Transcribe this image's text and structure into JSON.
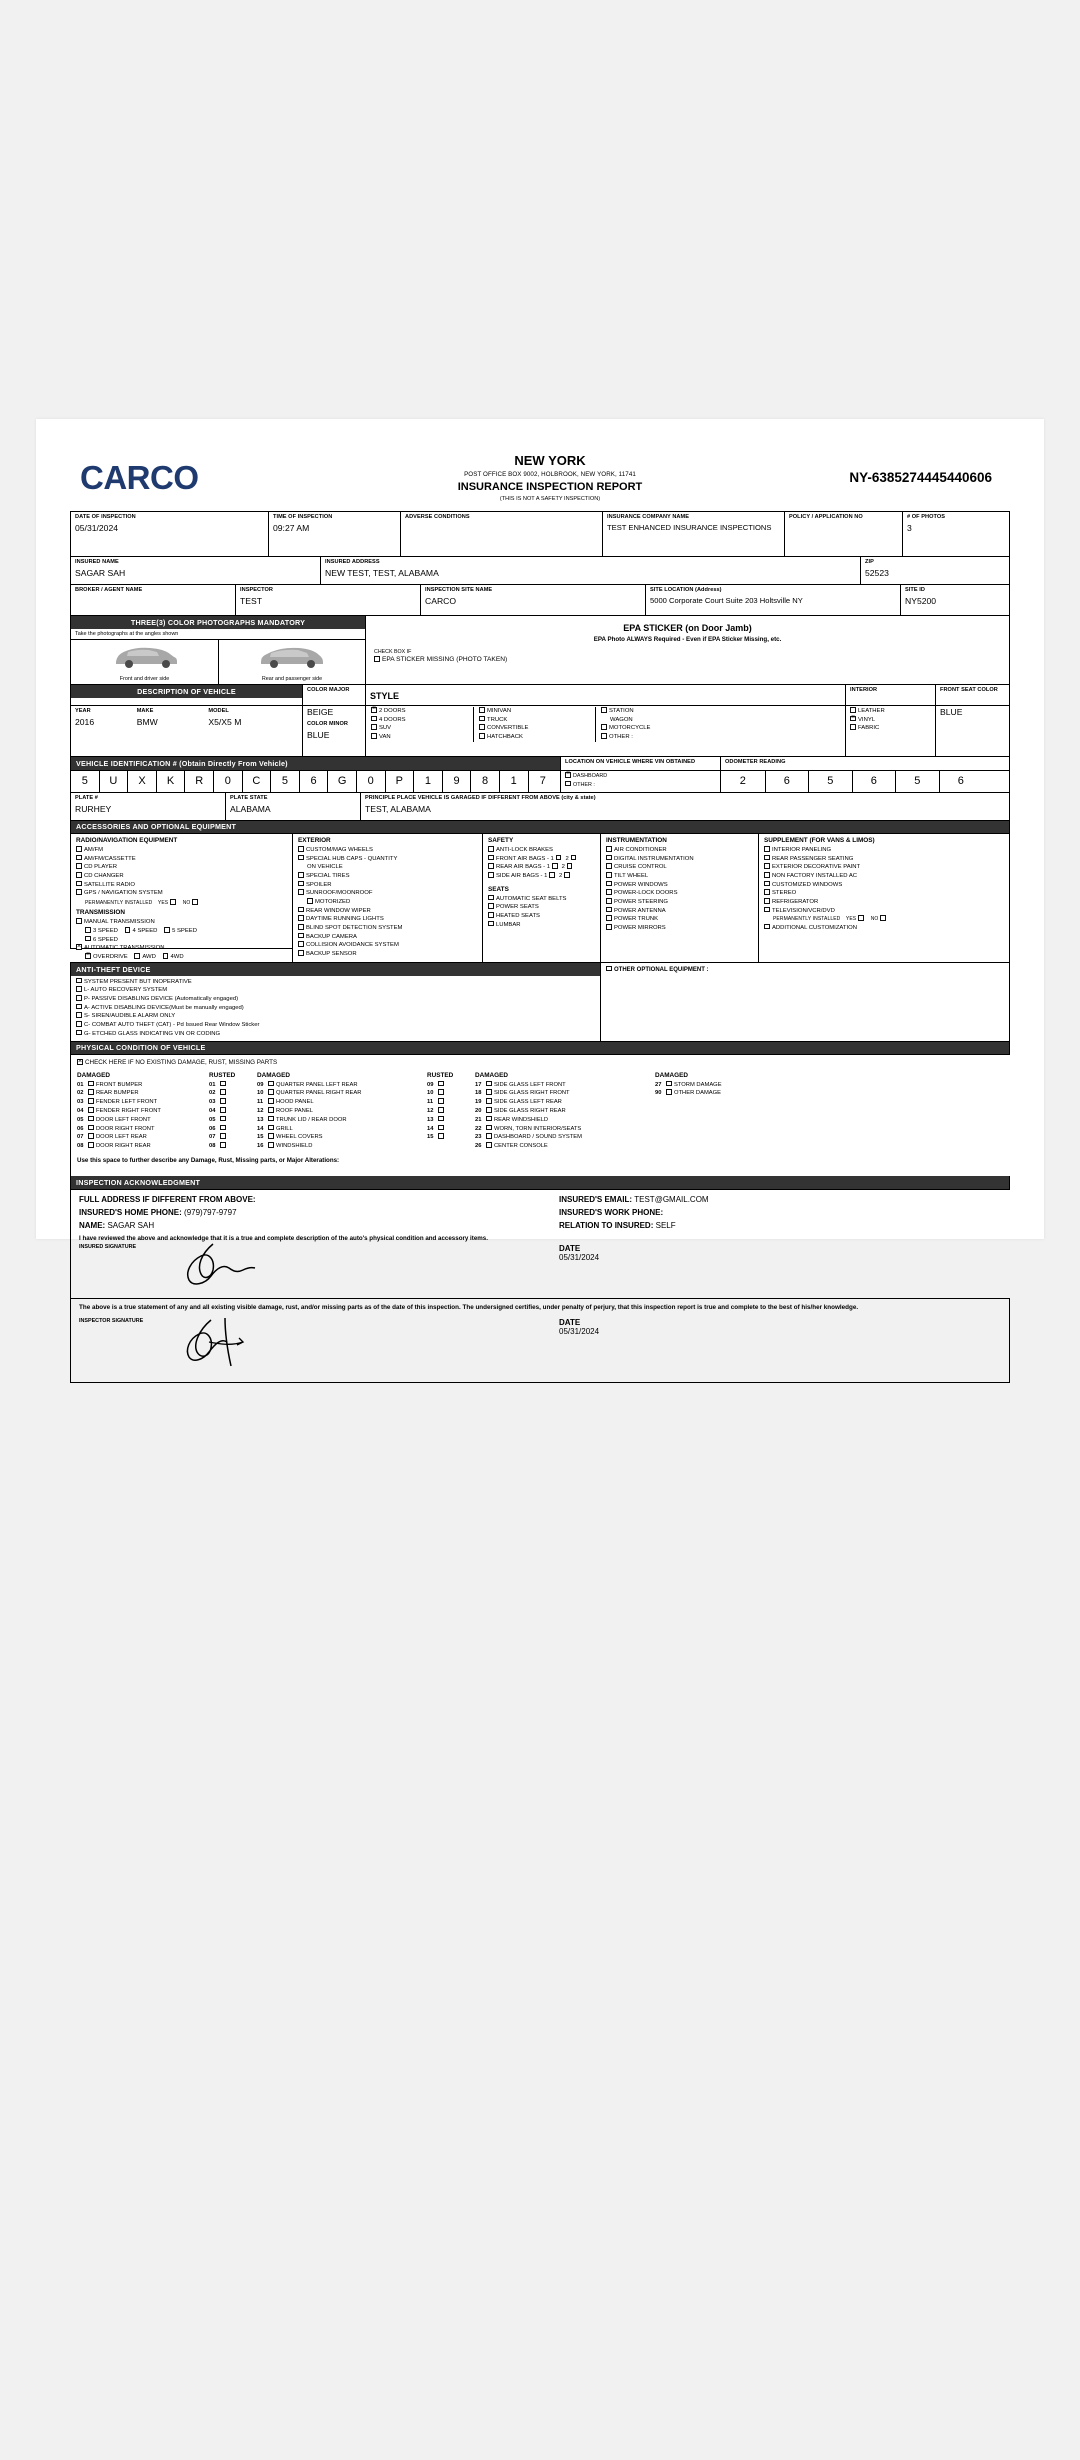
{
  "header": {
    "logo": "CARCO",
    "state": "NEW YORK",
    "address": "POST OFFICE BOX 9002, HOLBROOK, NEW YORK, 11741",
    "title": "INSURANCE INSPECTION REPORT",
    "note": "(THIS IS NOT A SAFETY INSPECTION)",
    "report_number": "NY-6385274445440606"
  },
  "inspection": {
    "date_label": "DATE OF INSPECTION",
    "date_value": "05/31/2024",
    "time_label": "TIME OF INSPECTION",
    "time_value": "09:27 AM",
    "adverse_label": "ADVERSE CONDITIONS",
    "adverse_value": "",
    "company_label": "INSURANCE COMPANY NAME",
    "company_value": "TEST ENHANCED INSURANCE INSPECTIONS",
    "policy_label": "POLICY / APPLICATION NO",
    "policy_value": "",
    "photos_label": "# OF PHOTOS",
    "photos_value": "3",
    "insured_name_label": "INSURED NAME",
    "insured_name_value": "SAGAR SAH",
    "insured_address_label": "INSURED ADDRESS",
    "insured_address_value": "NEW TEST, TEST, ALABAMA",
    "zip_label": "ZIP",
    "zip_value": "52523",
    "broker_label": "BROKER / AGENT NAME",
    "broker_value": "",
    "inspector_label": "INSPECTOR",
    "inspector_value": "TEST",
    "site_name_label": "INSPECTION SITE NAME",
    "site_name_value": "CARCO",
    "site_loc_label": "SITE LOCATION (Address)",
    "site_loc_value": "5000 Corporate Court Suite 203 Holtsville NY",
    "site_id_label": "SITE ID",
    "site_id_value": "NY5200"
  },
  "photos": {
    "band": "THREE(3) COLOR PHOTOGRAPHS MANDATORY",
    "note": "Take the photographs at the angles shown",
    "caption_left": "Front and driver side",
    "caption_right": "Rear and passenger side"
  },
  "epa": {
    "title": "EPA STICKER (on Door Jamb)",
    "subtitle": "EPA Photo ALWAYS Required - Even if EPA Sticker Missing, etc.",
    "checkbox_if": "CHECK BOX IF",
    "missing_label": "EPA STICKER MISSING (PHOTO TAKEN)",
    "missing_checked": false
  },
  "vehicle": {
    "band": "DESCRIPTION OF VEHICLE",
    "year_label": "YEAR",
    "year_value": "2016",
    "make_label": "MAKE",
    "make_value": "BMW",
    "model_label": "MODEL",
    "model_value": "X5/X5 M",
    "color_major_label": "COLOR MAJOR",
    "color_major_value": "BEIGE",
    "color_minor_label": "COLOR MINOR",
    "color_minor_value": "BLUE",
    "style_label": "STYLE",
    "style_col1": [
      {
        "label": "2 DOORS",
        "checked": true
      },
      {
        "label": "4 DOORS",
        "checked": false
      },
      {
        "label": "SUV",
        "checked": false
      },
      {
        "label": "VAN",
        "checked": false
      }
    ],
    "style_col2": [
      {
        "label": "MINIVAN",
        "checked": false
      },
      {
        "label": "TRUCK",
        "checked": false
      },
      {
        "label": "CONVERTIBLE",
        "checked": false
      },
      {
        "label": "HATCHBACK",
        "checked": false
      }
    ],
    "style_col3": [
      {
        "label": "STATION WAGON",
        "checked": false
      },
      {
        "label": "MOTORCYCLE",
        "checked": false
      },
      {
        "label": "OTHER :",
        "checked": false
      }
    ],
    "interior_label": "INTERIOR",
    "interior": [
      {
        "label": "LEATHER",
        "checked": false
      },
      {
        "label": "VINYL",
        "checked": true
      },
      {
        "label": "FABRIC",
        "checked": false
      }
    ],
    "front_seat_color_label": "FRONT SEAT COLOR",
    "front_seat_color_value": "BLUE"
  },
  "vin": {
    "band": "VEHICLE IDENTIFICATION # (Obtain Directly From Vehicle)",
    "chars": [
      "5",
      "U",
      "X",
      "K",
      "R",
      "0",
      "C",
      "5",
      "6",
      "G",
      "0",
      "P",
      "1",
      "9",
      "8",
      "1",
      "7"
    ],
    "location_label": "LOCATION ON VEHICLE WHERE VIN OBTAINED",
    "location_options": [
      {
        "label": "DASHBOARD",
        "checked": true
      },
      {
        "label": "OTHER :",
        "checked": false
      }
    ],
    "odometer_label": "ODOMETER READING",
    "odometer_digits": [
      "2",
      "6",
      "5",
      "6",
      "5",
      "6"
    ]
  },
  "plate": {
    "plate_label": "PLATE #",
    "plate_value": "RURHEY",
    "state_label": "PLATE STATE",
    "state_value": "ALABAMA",
    "garaged_label": "PRINCIPLE PLACE VEHICLE IS GARAGED IF DIFFERENT FROM ABOVE (city & state)",
    "garaged_value": "TEST, ALABAMA"
  },
  "accessories": {
    "band": "ACCESSORIES AND OPTIONAL EQUIPMENT",
    "radio_title": "RADIO/NAVIGATION EQUIPMENT",
    "radio": [
      {
        "label": "AM/FM",
        "checked": false
      },
      {
        "label": "AM/FM/CASSETTE",
        "checked": false
      },
      {
        "label": "CD PLAYER",
        "checked": false
      },
      {
        "label": "CD CHANGER",
        "checked": false
      },
      {
        "label": "SATELLITE RADIO",
        "checked": false
      },
      {
        "label": "GPS / NAVIGATION SYSTEM",
        "checked": false
      }
    ],
    "perm_installed": "PERMANENTLY INSTALLED",
    "yes_label": "YES",
    "no_label": "NO",
    "transmission_title": "TRANSMISSION",
    "manual_label": "MANUAL TRANSMISSION",
    "manual_checked": false,
    "speeds": [
      {
        "label": "3 SPEED",
        "checked": false
      },
      {
        "label": "4 SPEED",
        "checked": false
      },
      {
        "label": "5 SPEED",
        "checked": false
      },
      {
        "label": "6 SPEED",
        "checked": false
      }
    ],
    "automatic_label": "AUTOMATIC TRANSMISSION",
    "automatic_checked": true,
    "drive": [
      {
        "label": "OVERDRIVE",
        "checked": true
      },
      {
        "label": "AWD",
        "checked": false
      },
      {
        "label": "4WD",
        "checked": false
      }
    ],
    "exterior_title": "EXTERIOR",
    "exterior": [
      {
        "label": "CUSTOM/MAG WHEELS",
        "checked": false
      },
      {
        "label": "SPECIAL HUB CAPS - QUANTITY",
        "checked": false
      },
      {
        "label": "ON VEHICLE",
        "checked": null
      },
      {
        "label": "SPECIAL TIRES",
        "checked": false
      },
      {
        "label": "SPOILER",
        "checked": false
      },
      {
        "label": "SUNROOF/MOONROOF",
        "checked": false
      },
      {
        "label": "MOTORIZED",
        "checked": false,
        "indent": true
      },
      {
        "label": "REAR WINDOW WIPER",
        "checked": false
      },
      {
        "label": "DAYTIME RUNNING LIGHTS",
        "checked": false
      },
      {
        "label": "BLIND SPOT DETECTION SYSTEM",
        "checked": false
      },
      {
        "label": "BACKUP CAMERA",
        "checked": false
      },
      {
        "label": "COLLISION AVOIDANCE SYSTEM",
        "checked": false
      },
      {
        "label": "BACKUP SENSOR",
        "checked": false
      }
    ],
    "safety_title": "SAFETY",
    "safety": [
      {
        "label": "ANTI-LOCK BRAKES",
        "checked": false
      },
      {
        "label": "FRONT AIR BAGS -",
        "checked": false,
        "counts": true
      },
      {
        "label": "REAR AIR BAGS -",
        "checked": false,
        "counts": true
      },
      {
        "label": "SIDE AIR BAGS -",
        "checked": false,
        "counts": true
      }
    ],
    "seats_title": "SEATS",
    "seats": [
      {
        "label": "AUTOMATIC SEAT BELTS",
        "checked": false
      },
      {
        "label": "POWER SEATS",
        "checked": false
      },
      {
        "label": "HEATED SEATS",
        "checked": false
      },
      {
        "label": "LUMBAR",
        "checked": false
      }
    ],
    "instrumentation_title": "INSTRUMENTATION",
    "instrumentation": [
      {
        "label": "AIR CONDITIONER",
        "checked": false
      },
      {
        "label": "DIGITAL INSTRUMENTATION",
        "checked": false
      },
      {
        "label": "CRUISE CONTROL",
        "checked": false
      },
      {
        "label": "TILT WHEEL",
        "checked": false
      },
      {
        "label": "POWER WINDOWS",
        "checked": false
      },
      {
        "label": "POWER-LOCK DOORS",
        "checked": false
      },
      {
        "label": "POWER STEERING",
        "checked": false
      },
      {
        "label": "POWER ANTENNA",
        "checked": false
      },
      {
        "label": "POWER TRUNK",
        "checked": false
      },
      {
        "label": "POWER MIRRORS",
        "checked": false
      }
    ],
    "supplement_title": "SUPPLEMENT (FOR VANS & LIMOS)",
    "supplement": [
      {
        "label": "INTERIOR PANELING",
        "checked": false
      },
      {
        "label": "REAR PASSENGER SEATING",
        "checked": false
      },
      {
        "label": "EXTERIOR DECORATIVE PAINT",
        "checked": false
      },
      {
        "label": "NON FACTORY INSTALLED AC",
        "checked": false
      },
      {
        "label": "CUSTOMIZED WINDOWS",
        "checked": false
      },
      {
        "label": "STEREO",
        "checked": false
      },
      {
        "label": "REFRIGERATOR",
        "checked": false
      },
      {
        "label": "TELEVISION/VCR/DVD",
        "checked": false
      }
    ],
    "additional_customization": "ADDITIONAL CUSTOMIZATION",
    "other_optional": "OTHER OPTIONAL EQUIPMENT :"
  },
  "antitheft": {
    "band": "ANTI-THEFT DEVICE",
    "items": [
      {
        "label": "SYSTEM PRESENT BUT INOPERATIVE",
        "checked": false
      },
      {
        "label": "L- AUTO RECOVERY SYSTEM",
        "checked": false
      },
      {
        "label": "P- PASSIVE DISABLING DEVICE (Automatically engaged)",
        "checked": false
      },
      {
        "label": "A- ACTIVE DISABLING DEVICE(Must be manually engaged)",
        "checked": false
      },
      {
        "label": "S- SIREN/AUDIBLE ALARM ONLY",
        "checked": false
      },
      {
        "label": "C- COMBAT AUTO THEFT (CAT) - Pd Issued Rear Window Sticker",
        "checked": false
      },
      {
        "label": "G- ETCHED GLASS INDICATING VIN OR CODING",
        "checked": false
      }
    ]
  },
  "condition": {
    "band": "PHYSICAL CONDITION OF VEHICLE",
    "no_damage_label": "CHECK HERE IF NO EXISTING DAMAGE, RUST, MISSING PARTS",
    "no_damage_checked": true,
    "head_damaged": "DAMAGED",
    "head_rusted": "RUSTED",
    "damaged_1": [
      {
        "num": "01",
        "label": "FRONT BUMPER"
      },
      {
        "num": "02",
        "label": "REAR BUMPER"
      },
      {
        "num": "03",
        "label": "FENDER LEFT FRONT"
      },
      {
        "num": "04",
        "label": "FENDER RIGHT FRONT"
      },
      {
        "num": "05",
        "label": "DOOR LEFT FRONT"
      },
      {
        "num": "06",
        "label": "DOOR RIGHT FRONT"
      },
      {
        "num": "07",
        "label": "DOOR LEFT REAR"
      },
      {
        "num": "08",
        "label": "DOOR RIGHT REAR"
      }
    ],
    "rusted_1": [
      "01",
      "02",
      "03",
      "04",
      "05",
      "06",
      "07",
      "08"
    ],
    "damaged_2": [
      {
        "num": "09",
        "label": "QUARTER PANEL LEFT REAR"
      },
      {
        "num": "10",
        "label": "QUARTER PANEL RIGHT REAR"
      },
      {
        "num": "11",
        "label": "HOOD PANEL"
      },
      {
        "num": "12",
        "label": "ROOF PANEL"
      },
      {
        "num": "13",
        "label": "TRUNK LID / REAR DOOR"
      },
      {
        "num": "14",
        "label": "GRILL"
      },
      {
        "num": "15",
        "label": "WHEEL COVERS"
      },
      {
        "num": "16",
        "label": "WINDSHIELD"
      }
    ],
    "rusted_2": [
      "09",
      "10",
      "11",
      "12",
      "13",
      "14",
      "15"
    ],
    "damaged_3": [
      {
        "num": "17",
        "label": "SIDE GLASS LEFT FRONT"
      },
      {
        "num": "18",
        "label": "SIDE GLASS RIGHT FRONT"
      },
      {
        "num": "19",
        "label": "SIDE GLASS LEFT REAR"
      },
      {
        "num": "20",
        "label": "SIDE GLASS RIGHT REAR"
      },
      {
        "num": "21",
        "label": "REAR WINDSHIELD"
      },
      {
        "num": "22",
        "label": "WORN, TORN INTERIOR/SEATS"
      },
      {
        "num": "23",
        "label": "DASHBOARD / SOUND SYSTEM"
      },
      {
        "num": "26",
        "label": "CENTER CONSOLE"
      }
    ],
    "damaged_4": [
      {
        "num": "27",
        "label": "STORM DAMAGE"
      },
      {
        "num": "90",
        "label": "OTHER DAMAGE"
      }
    ],
    "free_text_label": "Use this space to further describe any Damage, Rust, Missing parts, or Major Alterations:",
    "free_text_value": ""
  },
  "acknowledgment": {
    "band": "INSPECTION ACKNOWLEDGMENT",
    "full_address_label": "FULL ADDRESS IF DIFFERENT FROM ABOVE:",
    "full_address_value": "",
    "home_phone_label": "INSURED'S HOME PHONE:",
    "home_phone_value": "(979)797-9797",
    "name_label": "NAME:",
    "name_value": "SAGAR SAH",
    "email_label": "INSURED'S EMAIL:",
    "email_value": "TEST@GMAIL.COM",
    "work_phone_label": "INSURED'S WORK PHONE:",
    "work_phone_value": "",
    "relation_label": "RELATION TO INSURED:",
    "relation_value": "SELF",
    "statement": "I have reviewed the above and acknowledge that it is a true and complete description of the auto's physical condition and accessory items.",
    "insured_sig_label": "INSURED SIGNATURE",
    "insured_date_label": "DATE",
    "insured_date_value": "05/31/2024"
  },
  "certification": {
    "text": "The above is a true statement of any and all existing visible damage, rust, and/or missing parts as of the date of this inspection. The undersigned certifies, under penalty of perjury, that this inspection report is true and complete to the best of his/her knowledge.",
    "inspector_sig_label": "INSPECTOR SIGNATURE",
    "inspector_date_label": "DATE",
    "inspector_date_value": "05/31/2024"
  }
}
